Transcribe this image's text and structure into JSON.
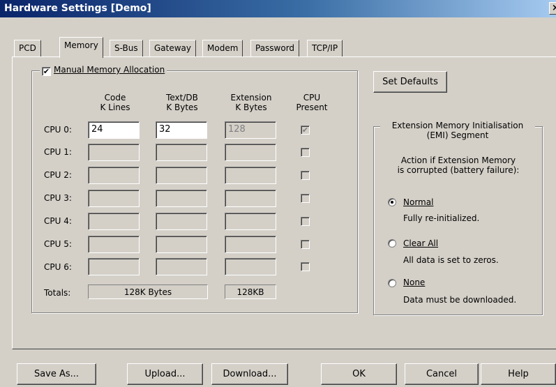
{
  "window": {
    "title": "Hardware Settings [Demo]",
    "close_label": "×"
  },
  "tabs": [
    "PCD",
    "Memory",
    "S-Bus",
    "Gateway",
    "Modem",
    "Password",
    "TCP/IP"
  ],
  "memory": {
    "group_label": "Manual Memory Allocation",
    "manual_checked": "✔",
    "columns": {
      "code": [
        "Code",
        "K Lines"
      ],
      "text": [
        "Text/DB",
        "K Bytes"
      ],
      "ext": [
        "Extension",
        "K Bytes"
      ],
      "cpu": [
        "CPU",
        "Present"
      ]
    },
    "rows": [
      {
        "label": "CPU 0:",
        "code": "24",
        "text": "32",
        "ext": "128",
        "present": "✔"
      },
      {
        "label": "CPU 1:",
        "code": "",
        "text": "",
        "ext": "",
        "present": ""
      },
      {
        "label": "CPU 2:",
        "code": "",
        "text": "",
        "ext": "",
        "present": ""
      },
      {
        "label": "CPU 3:",
        "code": "",
        "text": "",
        "ext": "",
        "present": ""
      },
      {
        "label": "CPU 4:",
        "code": "",
        "text": "",
        "ext": "",
        "present": ""
      },
      {
        "label": "CPU 5:",
        "code": "",
        "text": "",
        "ext": "",
        "present": ""
      },
      {
        "label": "CPU 6:",
        "code": "",
        "text": "",
        "ext": "",
        "present": ""
      }
    ],
    "totals_label": "Totals:",
    "totals_bytes": "128K Bytes",
    "totals_ext": "128KB"
  },
  "set_defaults_label": "Set Defaults",
  "emi": {
    "legend_line1": "Extension Memory Initialisation",
    "legend_line2": "(EMI) Segment",
    "question_line1": "Action if Extension Memory",
    "question_line2": "is corrupted (battery failure):",
    "options": [
      {
        "label": "Normal",
        "desc": "Fully re-initialized.",
        "selected": true
      },
      {
        "label": "Clear All",
        "desc": "All data is set to zeros.",
        "selected": false
      },
      {
        "label": "None",
        "desc": "Data must be downloaded.",
        "selected": false
      }
    ]
  },
  "buttons": {
    "save_as": "Save As...",
    "upload": "Upload...",
    "download": "Download...",
    "ok": "OK",
    "cancel": "Cancel",
    "help": "Help"
  }
}
